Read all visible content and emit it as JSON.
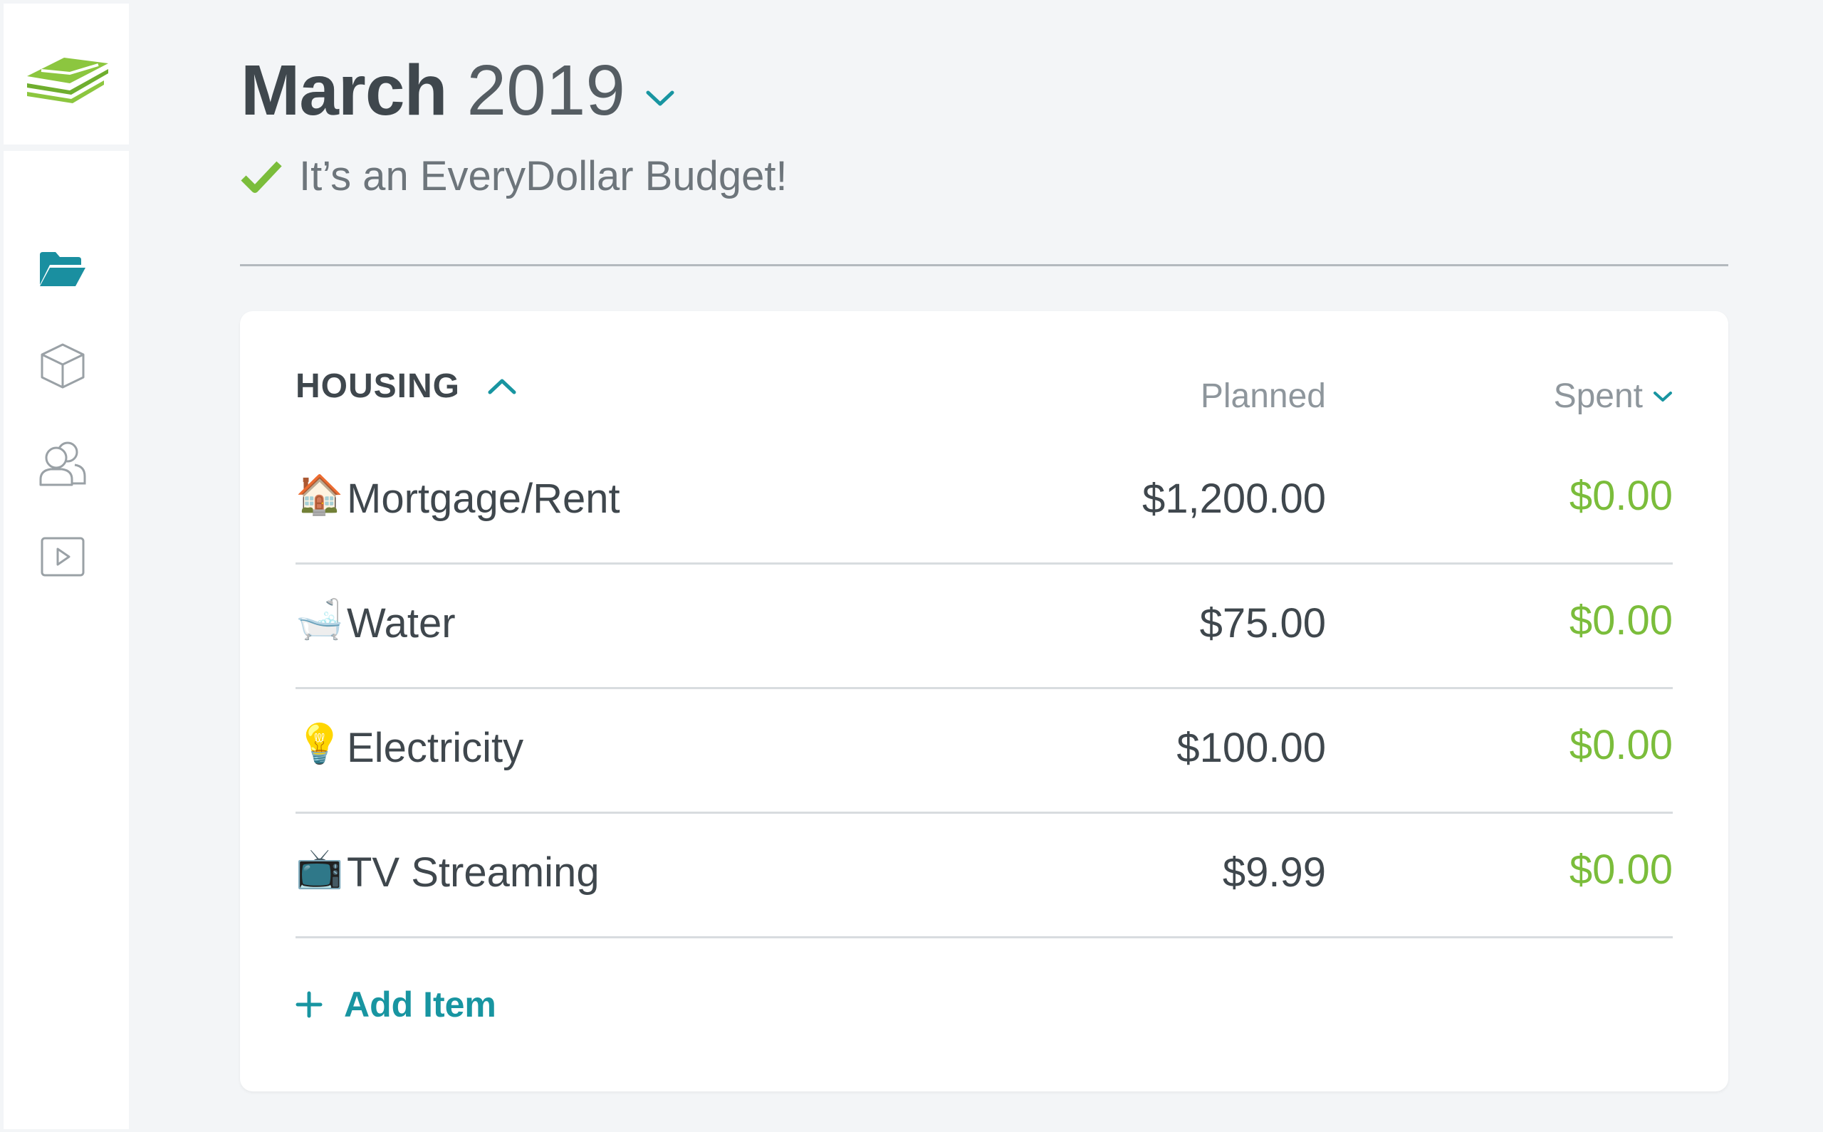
{
  "header": {
    "month": "March",
    "year": "2019",
    "status_text": "It’s an EveryDollar Budget!"
  },
  "sidebar": {
    "logo": "everydollar-logo",
    "items": [
      {
        "name": "budget",
        "icon": "folder-open-icon",
        "active": true
      },
      {
        "name": "transactions",
        "icon": "box-icon",
        "active": false
      },
      {
        "name": "people",
        "icon": "users-icon",
        "active": false
      },
      {
        "name": "videos",
        "icon": "play-icon",
        "active": false
      }
    ]
  },
  "group": {
    "title": "HOUSING",
    "planned_label": "Planned",
    "spent_label": "Spent",
    "items": [
      {
        "emoji": "🏠",
        "icon": "house-icon",
        "name": "Mortgage/Rent",
        "planned": "$1,200.00",
        "spent": "$0.00"
      },
      {
        "emoji": "🛁",
        "icon": "bathtub-icon",
        "name": "Water",
        "planned": "$75.00",
        "spent": "$0.00"
      },
      {
        "emoji": "💡",
        "icon": "lightbulb-icon",
        "name": "Electricity",
        "planned": "$100.00",
        "spent": "$0.00"
      },
      {
        "emoji": "📺",
        "icon": "television-icon",
        "name": "TV Streaming",
        "planned": "$9.99",
        "spent": "$0.00"
      }
    ],
    "add_item_label": "Add Item"
  },
  "colors": {
    "accent": "#1895a1",
    "positive": "#7bbd3b",
    "text": "#3f474d",
    "muted": "#8e969c"
  }
}
